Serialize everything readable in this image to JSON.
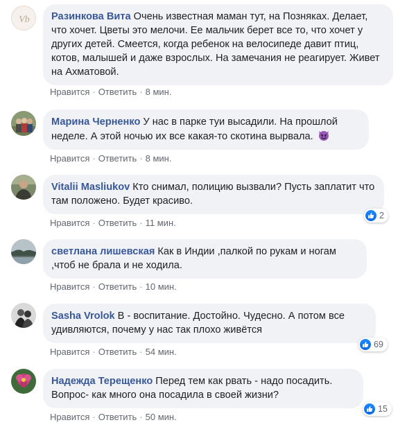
{
  "colors": {
    "author": "#385898",
    "bubble_bg": "#f0f2f5",
    "meta": "#606770",
    "like_blue": "#1877f2"
  },
  "comments": [
    {
      "author": "Разинкова Вита",
      "text": "Очень известная маман тут, на Позняках. Делает, что хочет. Цветы это мелочи. Ее мальчик берет все то, что хочет у других детей. Смеется, когда ребенок на велосипеде давит птиц, котов, малышей и даже взрослых. На замечания не реагирует. Живет на Ахматовой.",
      "like": "Нравится",
      "reply": "Ответить",
      "time": "8 мин.",
      "avatar_icon": "logo-avatar-icon"
    },
    {
      "author": "Марина Черненко",
      "text": "У нас в парке туи высадили. На прошлой неделе. А этой ночью их все какая-то скотина вырвала.",
      "emoji": "devil-emoji-icon",
      "like": "Нравится",
      "reply": "Ответить",
      "time": "8 мин.",
      "avatar_icon": "group-photo-avatar-icon"
    },
    {
      "author": "Vitalii Masliukov",
      "text": "Кто снимал, полицию вызвали? Пусть заплатит что там положено. Будет красиво.",
      "like": "Нравится",
      "reply": "Ответить",
      "time": "11 мин.",
      "reactions": "2",
      "avatar_icon": "person-photo-avatar-icon"
    },
    {
      "author": "светлана лишевская",
      "text": "Как в Индии ,палкой по рукам и ногам ,чтоб не брала и не ходила.",
      "like": "Нравится",
      "reply": "Ответить",
      "time": "10 мин.",
      "avatar_icon": "landscape-avatar-icon"
    },
    {
      "author": "Sasha Vrolok",
      "text": "В - воспитание. Достойно. Чудесно. А потом все удивляются, почему у нас так плохо живётся",
      "like": "Нравится",
      "reply": "Ответить",
      "time": "54 мин.",
      "reactions": "69",
      "avatar_icon": "bw-photo-avatar-icon"
    },
    {
      "author": "Надежда Терещенко",
      "text": "Перед тем как рвать - надо посадить. Вопрос- как много она посадила в своей жизни?",
      "like": "Нравится",
      "reply": "Ответить",
      "time": "50 мин.",
      "reactions": "15",
      "avatar_icon": "flower-avatar-icon"
    }
  ]
}
